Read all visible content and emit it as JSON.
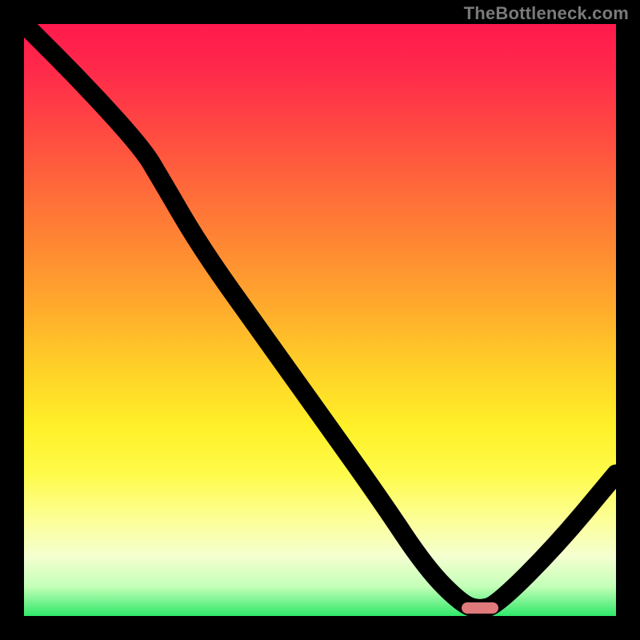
{
  "watermark": "TheBottleneck.com",
  "colors": {
    "frame": "#000000",
    "curve": "#000000",
    "marker": "#e07a7d",
    "gradient_top": "#ff1a4d",
    "gradient_bottom": "#2fe86a"
  },
  "chart_data": {
    "type": "line",
    "title": "",
    "xlabel": "",
    "ylabel": "",
    "xlim": [
      0,
      100
    ],
    "ylim": [
      0,
      100
    ],
    "grid": false,
    "legend": false,
    "annotations": [
      {
        "kind": "marker",
        "x": 77,
        "y": 1,
        "shape": "rounded-bar",
        "color": "#e07a7d"
      }
    ],
    "series": [
      {
        "name": "bottleneck-curve",
        "x": [
          0,
          10,
          20,
          23,
          30,
          40,
          50,
          60,
          68,
          74,
          77,
          80,
          90,
          100
        ],
        "y": [
          100,
          90,
          79,
          74,
          62,
          48,
          34,
          20,
          8,
          2,
          1,
          2,
          12,
          24
        ]
      }
    ],
    "background": "vertical-gradient red→green (bottleneck heatmap)"
  }
}
